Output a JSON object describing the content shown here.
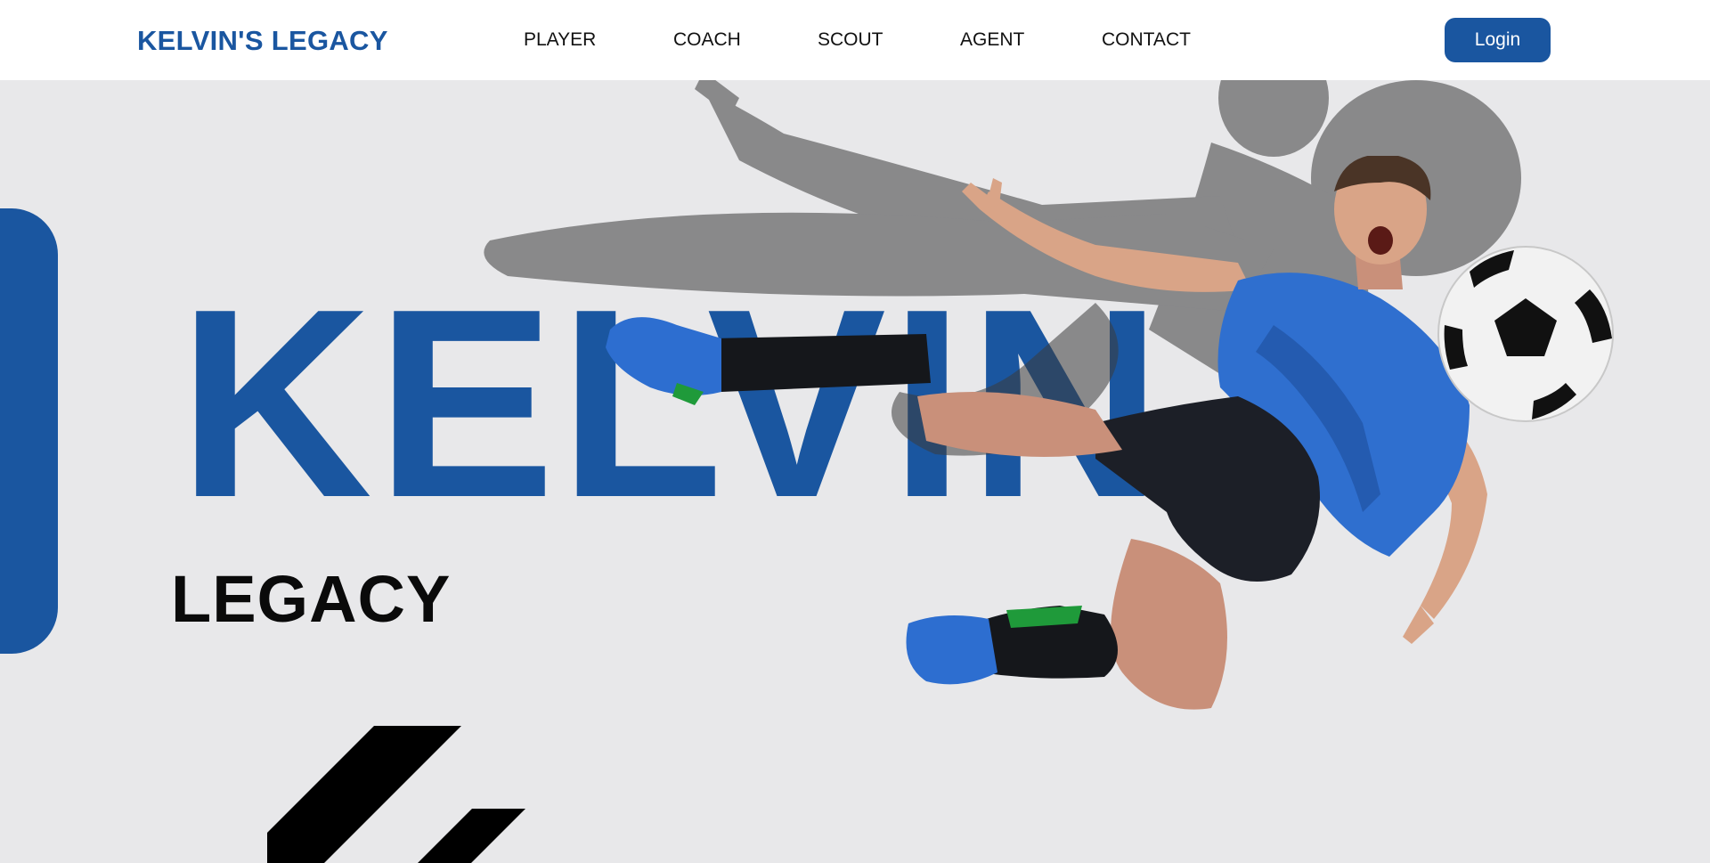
{
  "header": {
    "brand": "KELVIN'S LEGACY",
    "nav": [
      "PLAYER",
      "COACH",
      "SCOUT",
      "AGENT",
      "CONTACT"
    ],
    "login_label": "Login"
  },
  "hero": {
    "title": "KELVIN",
    "subtitle": "LEGACY",
    "image": "player-kicking-ball-illustration"
  },
  "colors": {
    "brand_blue": "#1a56a0",
    "background": "#e8e8ea",
    "header_bg": "#ffffff",
    "text_dark": "#0a0a0a"
  }
}
